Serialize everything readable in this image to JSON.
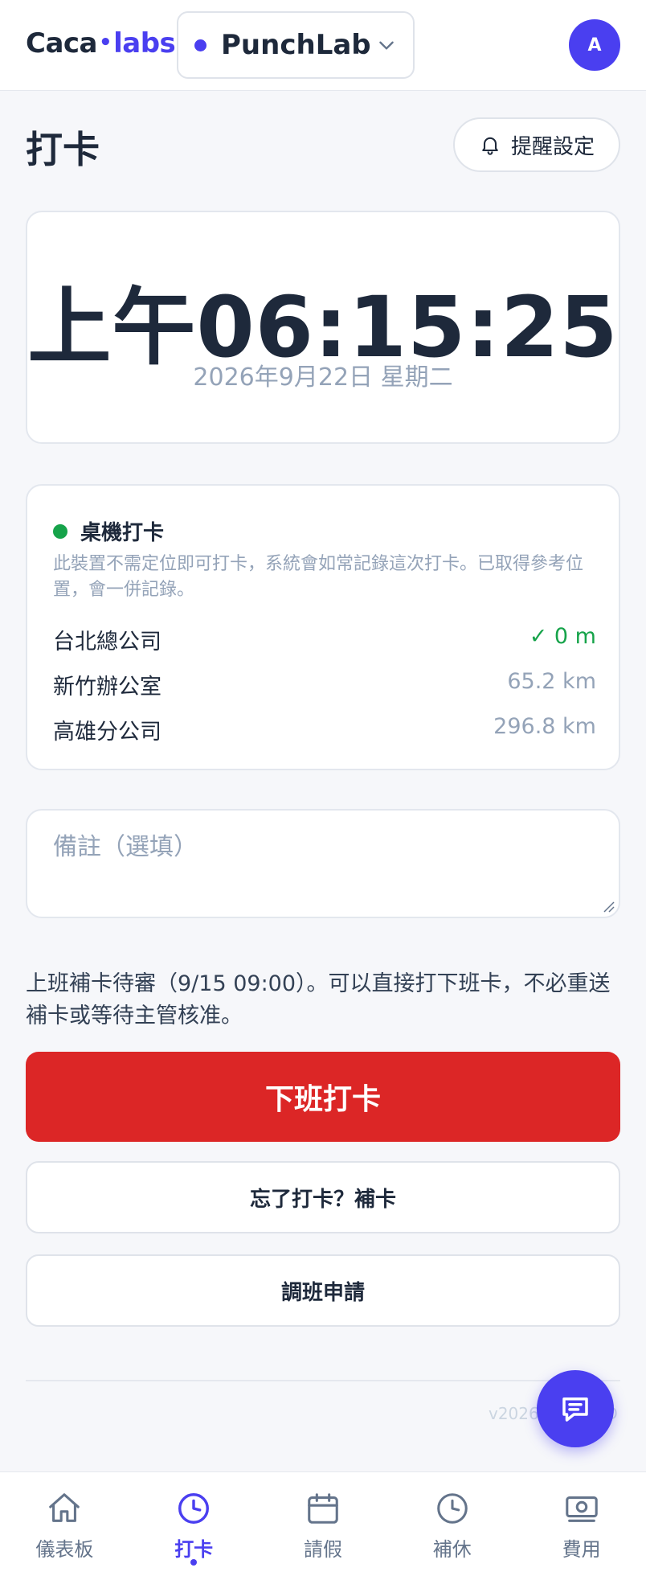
{
  "header": {
    "logo_part1": "Caca",
    "logo_dot": "•",
    "logo_part2": "labs",
    "org_name": "PunchLab",
    "avatar_initial": "A"
  },
  "page": {
    "title": "打卡",
    "reminder_label": "提醒設定"
  },
  "clock": {
    "time": "上午06:15:25",
    "date": "2026年9月22日 星期二"
  },
  "location": {
    "title": "桌機打卡",
    "description": "此裝置不需定位即可打卡，系統會如常記錄這次打卡。已取得參考位置，會一併記錄。",
    "offices": [
      {
        "name": "台北總公司",
        "distance": "✓ 0 m"
      },
      {
        "name": "新竹辦公室",
        "distance": "65.2 km"
      },
      {
        "name": "高雄分公司",
        "distance": "296.8 km"
      }
    ]
  },
  "note": {
    "placeholder": "備註（選填）"
  },
  "info_text": "上班補卡待審（9/15 09:00）。可以直接打下班卡，不必重送補卡或等待主管核准。",
  "actions": {
    "primary_label": "下班打卡",
    "forgot_label": "忘了打卡？補卡",
    "shift_label": "調班申請"
  },
  "footer": {
    "version": "v2026.09.22 · D"
  },
  "nav": {
    "items": [
      {
        "label": "儀表板",
        "icon": "home-icon"
      },
      {
        "label": "打卡",
        "icon": "clock-icon"
      },
      {
        "label": "請假",
        "icon": "calendar-icon"
      },
      {
        "label": "補休",
        "icon": "clock-icon"
      },
      {
        "label": "費用",
        "icon": "money-icon"
      }
    ],
    "active_index": 1
  },
  "colors": {
    "brand": "#4a3ff0",
    "danger": "#dc2626",
    "success": "#16a34a"
  }
}
